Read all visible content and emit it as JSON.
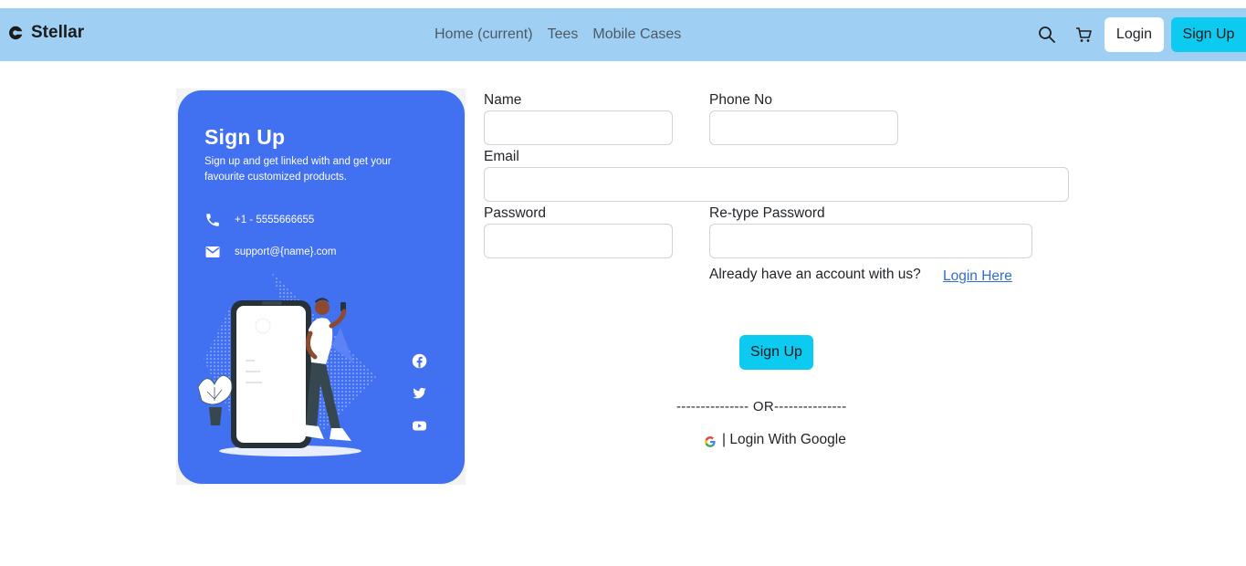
{
  "navbar": {
    "brand": "Stellar",
    "links": [
      "Home (current)",
      "Tees",
      "Mobile Cases"
    ],
    "login_label": "Login",
    "signup_label": "Sign Up",
    "icons": [
      "search-icon",
      "cart-icon"
    ],
    "background": "#9fd0f3"
  },
  "card": {
    "title": "Sign Up",
    "subtitle": "Sign up and get linked with and get your favourite customized products.",
    "phone": "+1 - 5555666655",
    "email": "support@{name}.com",
    "social_icons": [
      "facebook-icon",
      "twitter-icon",
      "youtube-icon"
    ],
    "background": "#4170f0"
  },
  "form": {
    "name_label": "Name",
    "phone_label": "Phone No",
    "email_label": "Email",
    "password_label": "Password",
    "retype_label": "Re-type Password",
    "name_value": "",
    "phone_value": "",
    "email_value": "",
    "password_value": "",
    "retype_value": "",
    "already_text": "Already have an account with us?",
    "login_link": "Login Here",
    "submit_label": "Sign Up",
    "or_text": "--------------- OR---------------",
    "google_label": "| Login With Google",
    "accent": "#0dcaf0"
  }
}
